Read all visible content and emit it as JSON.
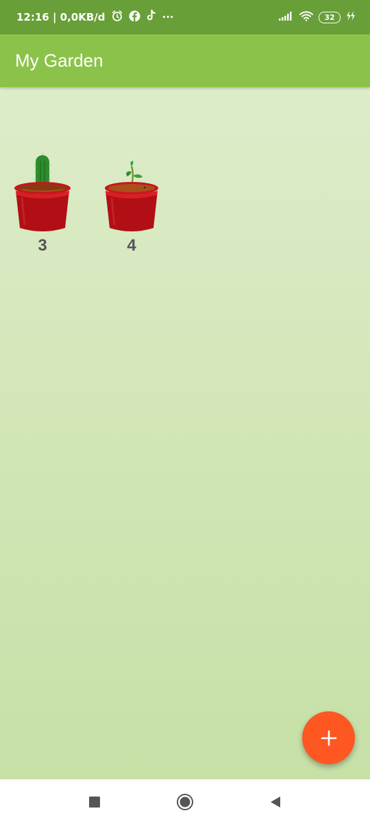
{
  "status_bar": {
    "time_info": "12:16 | 0,0KB/d",
    "more": "···",
    "battery": "32",
    "icons": [
      "alarm-icon",
      "facebook-icon",
      "tiktok-icon",
      "signal-icon",
      "wifi-icon",
      "battery-icon",
      "charging-icon"
    ],
    "background_color": "#689f38"
  },
  "app_bar": {
    "title": "My Garden",
    "background_color": "#8bc34a"
  },
  "garden": {
    "plants": [
      {
        "type": "cactus",
        "icon": "cactus-pot-icon",
        "count": "3"
      },
      {
        "type": "sprout",
        "icon": "sprout-pot-icon",
        "count": "4"
      }
    ]
  },
  "fab": {
    "icon": "plus-icon",
    "color": "#ff5722"
  },
  "nav_bar": {
    "icons": [
      "recents-square-icon",
      "home-circle-icon",
      "back-triangle-icon"
    ]
  }
}
